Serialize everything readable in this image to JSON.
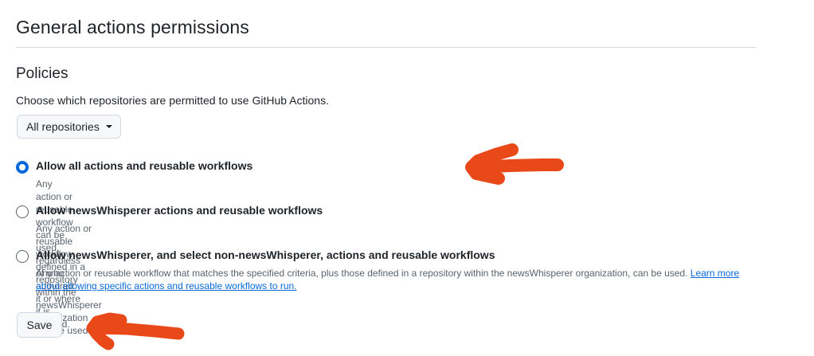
{
  "page": {
    "title": "General actions permissions"
  },
  "policies": {
    "heading": "Policies",
    "description": "Choose which repositories are permitted to use GitHub Actions.",
    "dropdown": {
      "selected": "All repositories"
    },
    "options": [
      {
        "label": "Allow all actions and reusable workflows",
        "description": "Any action or reusable workflow can be used, regardless of who authored it or where it is defined.",
        "checked": true
      },
      {
        "label": "Allow newsWhisperer actions and reusable workflows",
        "description": "Any action or reusable workflow defined in a repository within the newsWhisperer organization can be used.",
        "checked": false
      },
      {
        "label": "Allow newsWhisperer, and select non-newsWhisperer, actions and reusable workflows",
        "description": "Any action or reusable workflow that matches the specified criteria, plus those defined in a repository within the newsWhisperer organization, can be used.",
        "link_text": "Learn more about allowing specific actions and reusable workflows to run.",
        "checked": false
      }
    ]
  },
  "actions": {
    "save_label": "Save"
  },
  "colors": {
    "accent": "#0969da",
    "annotation": "#e94819"
  }
}
